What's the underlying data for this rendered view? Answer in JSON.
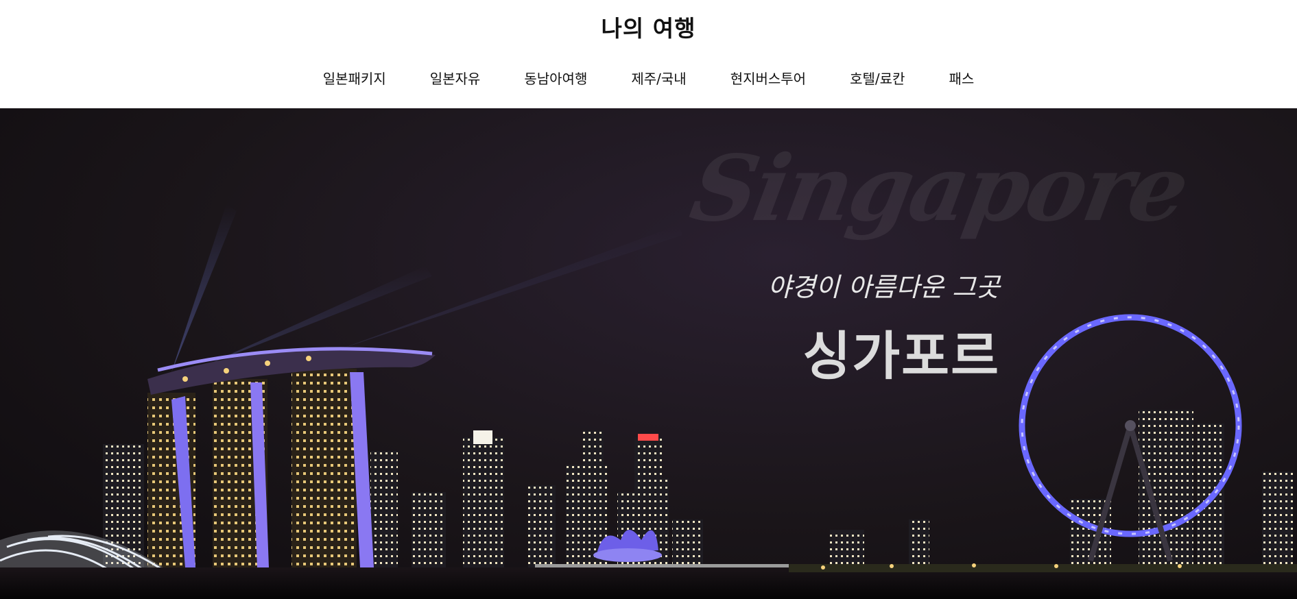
{
  "header": {
    "title": "나의 여행"
  },
  "nav": {
    "items": [
      {
        "label": "일본패키지"
      },
      {
        "label": "일본자유"
      },
      {
        "label": "동남아여행"
      },
      {
        "label": "제주/국내"
      },
      {
        "label": "현지버스투어"
      },
      {
        "label": "호텔/료칸"
      },
      {
        "label": "패스"
      }
    ]
  },
  "hero": {
    "watermark": "Singapore",
    "tagline": "야경이 아름다운 그곳",
    "title": "싱가포르"
  }
}
